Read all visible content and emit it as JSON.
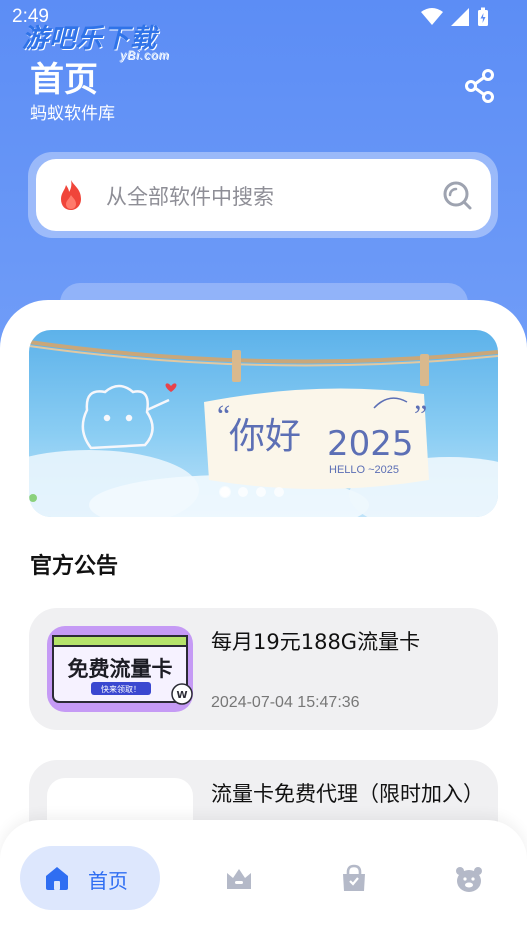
{
  "status_bar": {
    "time": "2:49"
  },
  "watermark": {
    "text": "游吧乐下载",
    "sub": "yBi.com"
  },
  "header": {
    "title": "首页",
    "subtitle": "蚂蚁软件库"
  },
  "search": {
    "placeholder": "从全部软件中搜索"
  },
  "banner": {
    "headline_open_quote": "“",
    "headline": "你好",
    "year": "2025",
    "headline_close_quote": "”",
    "caption": "HELLO ~2025",
    "dots_count": 4,
    "active_dot": 1
  },
  "announcements": {
    "title": "官方公告",
    "items": [
      {
        "title": "每月19元188G流量卡",
        "date": "2024-07-04 15:47:36",
        "thumb_text": "免费流量卡",
        "thumb_button": "快来领取！"
      },
      {
        "title": "流量卡免费代理（限时加入）",
        "date": ""
      }
    ]
  },
  "bottom_nav": {
    "items": [
      {
        "label": "首页",
        "icon": "home-icon",
        "active": true
      },
      {
        "label": "",
        "icon": "crown-icon",
        "active": false
      },
      {
        "label": "",
        "icon": "bag-icon",
        "active": false
      },
      {
        "label": "",
        "icon": "bear-icon",
        "active": false
      }
    ]
  },
  "colors": {
    "primary": "#5c8df5",
    "nav_active_bg": "#dde7fd",
    "nav_active": "#2f6ef2",
    "icon_inactive": "#b4b9c8"
  }
}
